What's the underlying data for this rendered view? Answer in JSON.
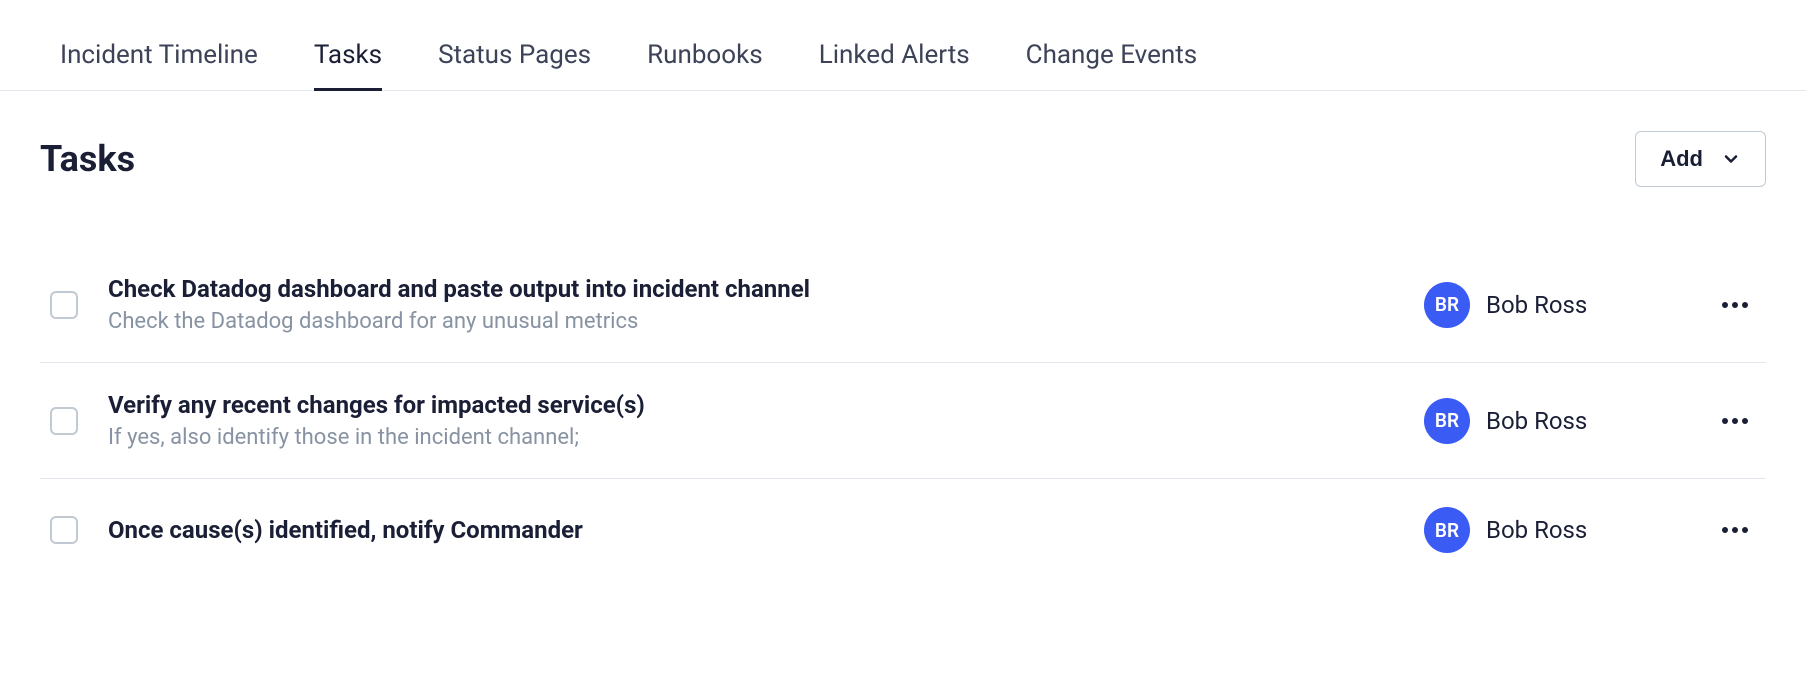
{
  "tabs": [
    {
      "label": "Incident Timeline",
      "active": false
    },
    {
      "label": "Tasks",
      "active": true
    },
    {
      "label": "Status Pages",
      "active": false
    },
    {
      "label": "Runbooks",
      "active": false
    },
    {
      "label": "Linked Alerts",
      "active": false
    },
    {
      "label": "Change Events",
      "active": false
    }
  ],
  "section": {
    "title": "Tasks",
    "add_label": "Add"
  },
  "tasks": [
    {
      "title": "Check Datadog dashboard and paste output into incident channel",
      "description": "Check the Datadog dashboard for any unusual metrics",
      "assignee_initials": "BR",
      "assignee_name": "Bob Ross"
    },
    {
      "title": "Verify any recent changes for impacted service(s)",
      "description": "If yes, also identify those in the incident channel;",
      "assignee_initials": "BR",
      "assignee_name": "Bob Ross"
    },
    {
      "title": "Once cause(s) identified, notify Commander",
      "description": "",
      "assignee_initials": "BR",
      "assignee_name": "Bob Ross"
    }
  ]
}
